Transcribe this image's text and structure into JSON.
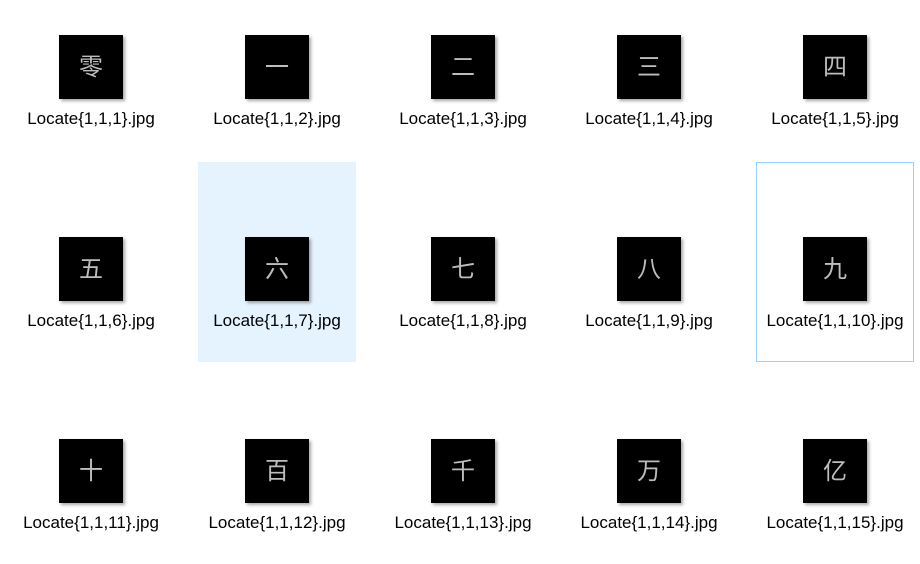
{
  "view": {
    "selected_index": 6,
    "focused_index": 9
  },
  "files": [
    {
      "label": "Locate{1,1,1}.jpg",
      "glyph": "零"
    },
    {
      "label": "Locate{1,1,2}.jpg",
      "glyph": "一"
    },
    {
      "label": "Locate{1,1,3}.jpg",
      "glyph": "二"
    },
    {
      "label": "Locate{1,1,4}.jpg",
      "glyph": "三"
    },
    {
      "label": "Locate{1,1,5}.jpg",
      "glyph": "四"
    },
    {
      "label": "Locate{1,1,6}.jpg",
      "glyph": "五"
    },
    {
      "label": "Locate{1,1,7}.jpg",
      "glyph": "六"
    },
    {
      "label": "Locate{1,1,8}.jpg",
      "glyph": "七"
    },
    {
      "label": "Locate{1,1,9}.jpg",
      "glyph": "八"
    },
    {
      "label": "Locate{1,1,10}.jpg",
      "glyph": "九"
    },
    {
      "label": "Locate{1,1,11}.jpg",
      "glyph": "十"
    },
    {
      "label": "Locate{1,1,12}.jpg",
      "glyph": "百"
    },
    {
      "label": "Locate{1,1,13}.jpg",
      "glyph": "千"
    },
    {
      "label": "Locate{1,1,14}.jpg",
      "glyph": "万"
    },
    {
      "label": "Locate{1,1,15}.jpg",
      "glyph": "亿"
    }
  ]
}
